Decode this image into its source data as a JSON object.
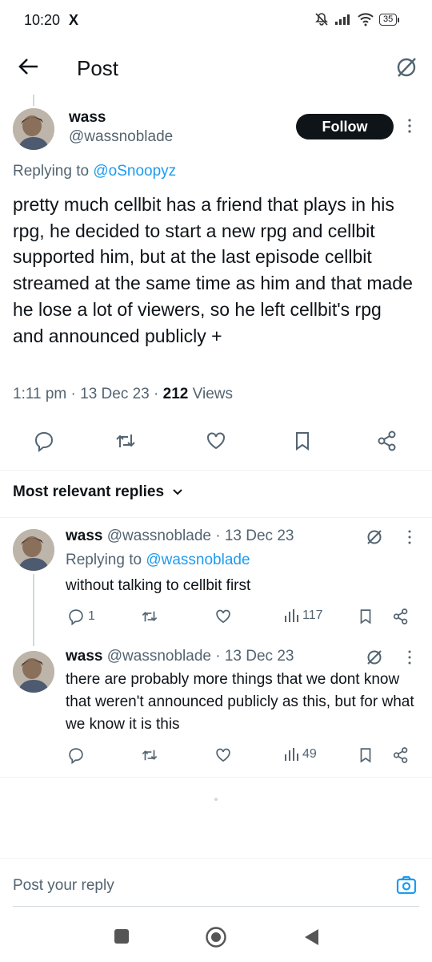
{
  "status_bar": {
    "time": "10:20",
    "app_icon": "X",
    "battery": "35"
  },
  "header": {
    "title": "Post"
  },
  "main_post": {
    "author_name": "wass",
    "author_handle": "@wassnoblade",
    "follow_label": "Follow",
    "replying_prefix": "Replying to ",
    "replying_to": "@oSnoopyz",
    "text": "pretty much cellbit has a friend that plays in his rpg, he decided to start a new rpg and cellbit supported him, but at the last episode cellbit streamed at the same time as him and that made he lose a lot of viewers, so he left cellbit's rpg and announced publicly +",
    "time": "1:11 pm",
    "date": "13 Dec 23",
    "views_count": "212",
    "views_label": "Views"
  },
  "replies_header": {
    "label": "Most relevant replies"
  },
  "replies": [
    {
      "author_name": "wass",
      "author_handle": "@wassnoblade",
      "date": "13 Dec 23",
      "replying_prefix": "Replying to ",
      "replying_to": "@wassnoblade",
      "text": "without talking to cellbit first",
      "reply_count": "1",
      "views": "117"
    },
    {
      "author_name": "wass",
      "author_handle": "@wassnoblade",
      "date": "13 Dec 23",
      "text": "there are probably more things that we dont know that weren't announced publicly as this, but for what we know it is this",
      "views": "49"
    }
  ],
  "composer": {
    "placeholder": "Post your reply"
  },
  "colors": {
    "accent": "#1d9bf0",
    "text": "#0f1419",
    "secondary": "#536471",
    "divider": "#eff3f4"
  }
}
